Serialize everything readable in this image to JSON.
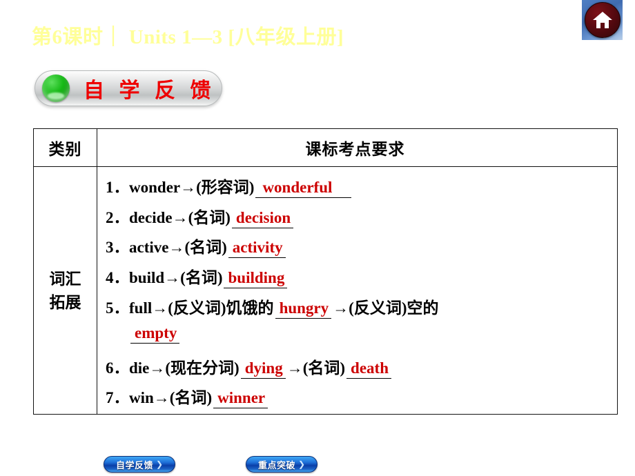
{
  "header": {
    "title": "第6课时｜ Units 1—3 [八年级上册]",
    "home_icon": "home-icon"
  },
  "banner": {
    "title": "自 学 反 馈",
    "bullet_icon": "green-sphere-bullet"
  },
  "table": {
    "headers": {
      "category": "类别",
      "requirement": "课标考点要求"
    },
    "category_label_line1": "词汇",
    "category_label_line2": "拓展",
    "items": [
      {
        "num": "1．",
        "prompt": "wonder→(形容词)",
        "answer": "wonderful",
        "prompt2": "",
        "answer2": ""
      },
      {
        "num": "2．",
        "prompt": "decide→(名词)",
        "answer": "decision",
        "prompt2": "",
        "answer2": ""
      },
      {
        "num": "3．",
        "prompt": "active→(名词)",
        "answer": "activity",
        "prompt2": "",
        "answer2": ""
      },
      {
        "num": "4．",
        "prompt": "build→(名词)",
        "answer": "building",
        "prompt2": "",
        "answer2": ""
      },
      {
        "num": "5．",
        "prompt": "full→(反义词)饥饿的",
        "answer": "hungry",
        "prompt2": "→(反义词)空的",
        "answer2": "",
        "continuation_answer": "empty"
      },
      {
        "num": "6．",
        "prompt": "die→(现在分词)",
        "answer": "dying",
        "prompt2": "→(名词)",
        "answer2": "death"
      },
      {
        "num": "7．",
        "prompt": "win→(名词)",
        "answer": "winner",
        "prompt2": "",
        "answer2": ""
      }
    ]
  },
  "bottom_nav": {
    "self_study": "自学反馈",
    "key_points": "重点突破",
    "chevron": "❯"
  },
  "colors": {
    "header_text": "#ffff99",
    "banner_text": "#ee0000",
    "answer_red": "#cc0000",
    "nav_blue": "#1f6fd8",
    "home_red": "#5a0a10",
    "background": "#ffffff"
  }
}
